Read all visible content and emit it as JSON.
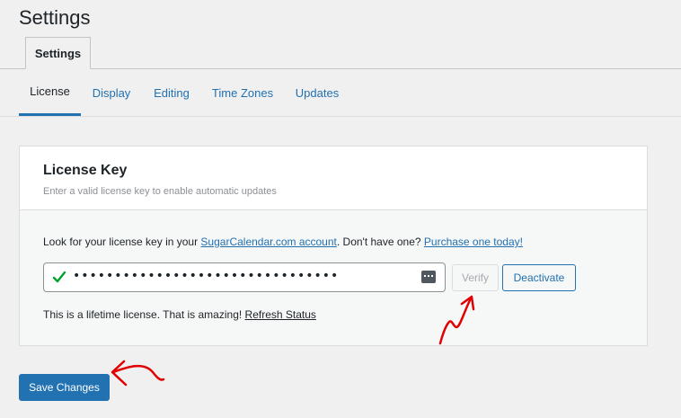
{
  "page": {
    "title": "Settings"
  },
  "top_tabs": [
    {
      "label": "Settings",
      "active": true
    }
  ],
  "sub_tabs": [
    {
      "label": "License",
      "active": true
    },
    {
      "label": "Display",
      "active": false
    },
    {
      "label": "Editing",
      "active": false
    },
    {
      "label": "Time Zones",
      "active": false
    },
    {
      "label": "Updates",
      "active": false
    }
  ],
  "license_card": {
    "title": "License Key",
    "description": "Enter a valid license key to enable automatic updates",
    "look_text_before": "Look for your license key in your ",
    "account_link": "SugarCalendar.com account",
    "look_text_middle": ". Don't have one? ",
    "purchase_link": "Purchase one today!",
    "key_value": "••••••••••••••••••••••••••••••••",
    "verify_label": "Verify",
    "deactivate_label": "Deactivate",
    "status_text": "This is a lifetime license. That is amazing! ",
    "refresh_link": "Refresh Status"
  },
  "footer": {
    "save_label": "Save Changes"
  },
  "colors": {
    "accent": "#2271b1",
    "valid_check": "#00a32a",
    "annotation": "#e00000",
    "background": "#f0f0f1"
  },
  "icons": {
    "valid": "checkmark-icon",
    "password_manager": "password-manager-icon"
  }
}
